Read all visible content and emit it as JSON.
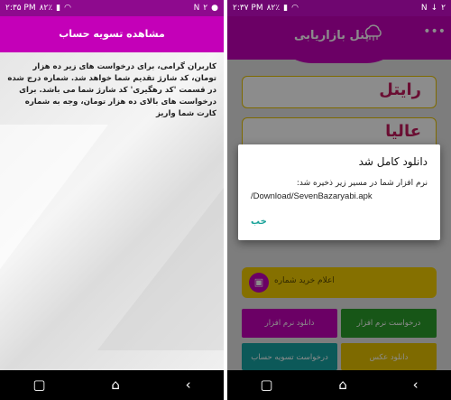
{
  "left": {
    "status": {
      "time": "۲:۳۵ PM",
      "battery": "۸۲٪",
      "carrier": "۲"
    },
    "appbar_title": "مشاهده تسویه حساب",
    "message": "کاربران گرامی، برای درخواست های زیر ده هزار تومان، کد شارژ تقدیم شما خواهد شد. شماره درج شده در قسمت 'کد رهگیری' کد شارژ شما می باشد. برای درخواست های بالای ده هزار تومان، وجه به شماره کارت شما واریز"
  },
  "right": {
    "status": {
      "time": "۲:۳۷ PM",
      "battery": "۸۲٪",
      "carrier": "۲"
    },
    "app_title": "پنل بازاریابی",
    "cards": [
      "رایتل",
      "عالیا"
    ],
    "yellow_label": "اعلام خرید شماره",
    "buttons": {
      "download_app": "دانلود نرم افزار",
      "request_app": "درخواست نرم افزار",
      "request_settlement": "درخواست تسویه حساب",
      "download_photo": "دانلود عکس"
    },
    "dialog": {
      "title": "دانلود کامل شد",
      "message": "نرم افزار شما در مسیر زیر ذخیره شد:",
      "path": "/Download/SevenBazaryabi.apk",
      "ok": "خب"
    }
  },
  "colors": {
    "magenta": "#c400b8",
    "yellow": "#f2cd00",
    "green": "#2a9d2a",
    "teal": "#17a2a2"
  }
}
